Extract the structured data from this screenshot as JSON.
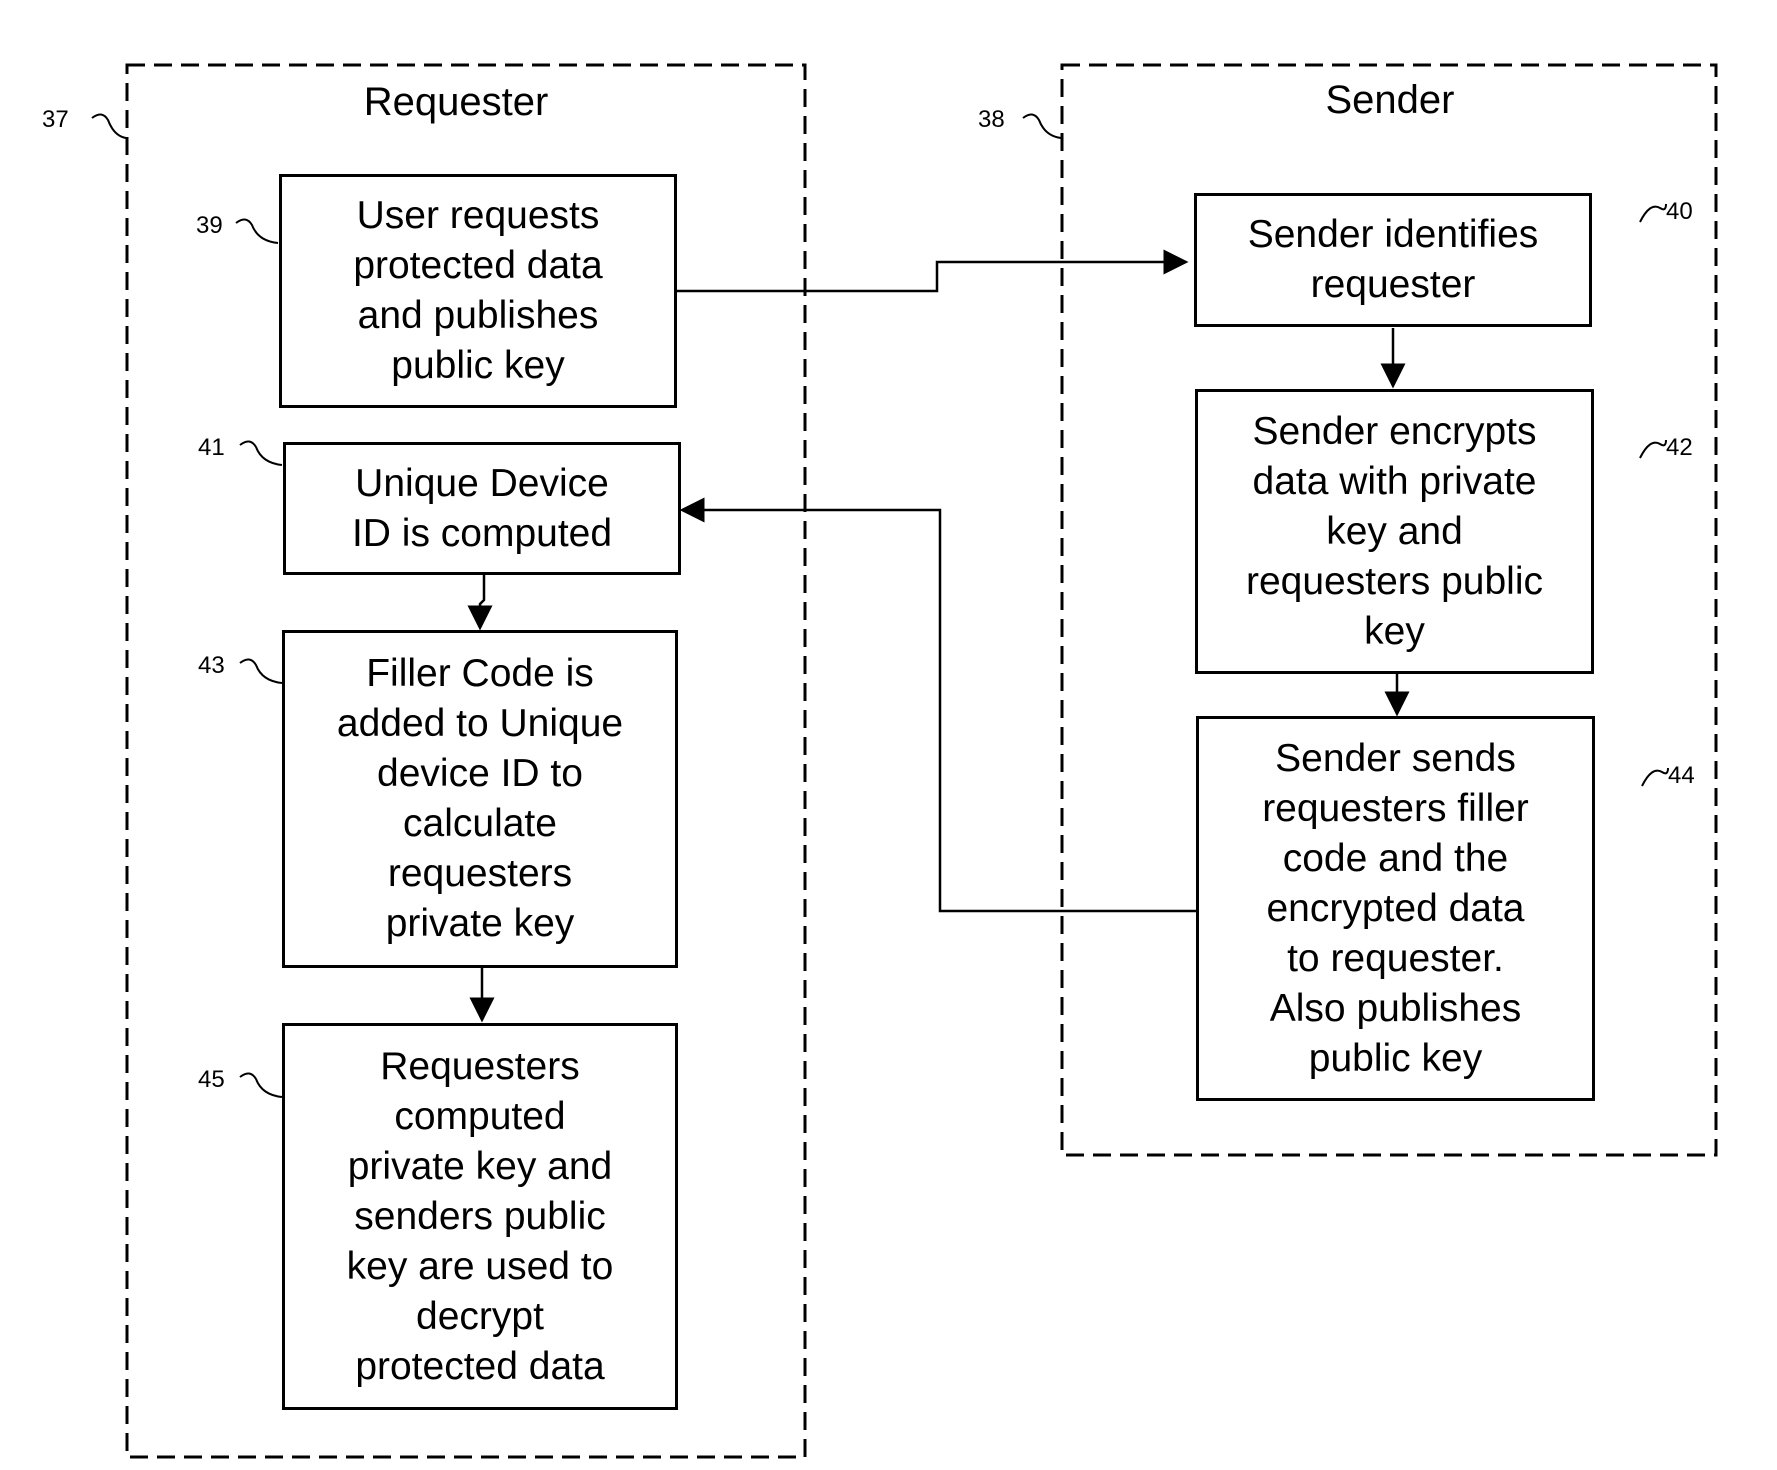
{
  "lanes": [
    {
      "id": "requester",
      "ref": "37",
      "title": "Requester"
    },
    {
      "id": "sender",
      "ref": "38",
      "title": "Sender"
    }
  ],
  "steps": [
    {
      "ref": "39",
      "lane": "requester",
      "text": "User requests\nprotected data\nand publishes\npublic key"
    },
    {
      "ref": "40",
      "lane": "sender",
      "text": "Sender identifies\nrequester"
    },
    {
      "ref": "41",
      "lane": "requester",
      "text": "Unique Device\nID is computed"
    },
    {
      "ref": "42",
      "lane": "sender",
      "text": "Sender encrypts\ndata with private\nkey and\nrequesters public\nkey"
    },
    {
      "ref": "43",
      "lane": "requester",
      "text": "Filler Code is\nadded to Unique\ndevice ID to\ncalculate\nrequesters\nprivate key"
    },
    {
      "ref": "44",
      "lane": "sender",
      "text": "Sender sends\nrequesters filler\ncode and the\nencrypted data\nto requester.\nAlso publishes\npublic key"
    },
    {
      "ref": "45",
      "lane": "requester",
      "text": "Requesters\ncomputed\nprivate key and\nsenders public\nkey are used to\ndecrypt\nprotected data"
    }
  ],
  "connections": [
    {
      "from": "39",
      "to": "40"
    },
    {
      "from": "40",
      "to": "42"
    },
    {
      "from": "42",
      "to": "44"
    },
    {
      "from": "44",
      "to": "41"
    },
    {
      "from": "41",
      "to": "43"
    },
    {
      "from": "43",
      "to": "45"
    }
  ]
}
